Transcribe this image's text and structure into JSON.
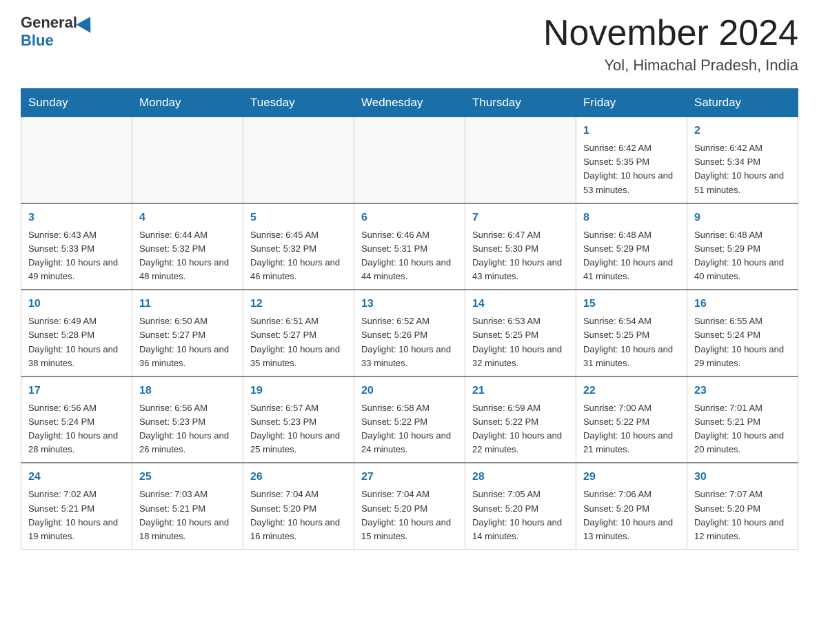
{
  "header": {
    "logo_general": "General",
    "logo_blue": "Blue",
    "month_title": "November 2024",
    "location": "Yol, Himachal Pradesh, India"
  },
  "days_of_week": [
    "Sunday",
    "Monday",
    "Tuesday",
    "Wednesday",
    "Thursday",
    "Friday",
    "Saturday"
  ],
  "weeks": [
    {
      "days": [
        {
          "number": "",
          "info": ""
        },
        {
          "number": "",
          "info": ""
        },
        {
          "number": "",
          "info": ""
        },
        {
          "number": "",
          "info": ""
        },
        {
          "number": "",
          "info": ""
        },
        {
          "number": "1",
          "info": "Sunrise: 6:42 AM\nSunset: 5:35 PM\nDaylight: 10 hours and 53 minutes."
        },
        {
          "number": "2",
          "info": "Sunrise: 6:42 AM\nSunset: 5:34 PM\nDaylight: 10 hours and 51 minutes."
        }
      ]
    },
    {
      "days": [
        {
          "number": "3",
          "info": "Sunrise: 6:43 AM\nSunset: 5:33 PM\nDaylight: 10 hours and 49 minutes."
        },
        {
          "number": "4",
          "info": "Sunrise: 6:44 AM\nSunset: 5:32 PM\nDaylight: 10 hours and 48 minutes."
        },
        {
          "number": "5",
          "info": "Sunrise: 6:45 AM\nSunset: 5:32 PM\nDaylight: 10 hours and 46 minutes."
        },
        {
          "number": "6",
          "info": "Sunrise: 6:46 AM\nSunset: 5:31 PM\nDaylight: 10 hours and 44 minutes."
        },
        {
          "number": "7",
          "info": "Sunrise: 6:47 AM\nSunset: 5:30 PM\nDaylight: 10 hours and 43 minutes."
        },
        {
          "number": "8",
          "info": "Sunrise: 6:48 AM\nSunset: 5:29 PM\nDaylight: 10 hours and 41 minutes."
        },
        {
          "number": "9",
          "info": "Sunrise: 6:48 AM\nSunset: 5:29 PM\nDaylight: 10 hours and 40 minutes."
        }
      ]
    },
    {
      "days": [
        {
          "number": "10",
          "info": "Sunrise: 6:49 AM\nSunset: 5:28 PM\nDaylight: 10 hours and 38 minutes."
        },
        {
          "number": "11",
          "info": "Sunrise: 6:50 AM\nSunset: 5:27 PM\nDaylight: 10 hours and 36 minutes."
        },
        {
          "number": "12",
          "info": "Sunrise: 6:51 AM\nSunset: 5:27 PM\nDaylight: 10 hours and 35 minutes."
        },
        {
          "number": "13",
          "info": "Sunrise: 6:52 AM\nSunset: 5:26 PM\nDaylight: 10 hours and 33 minutes."
        },
        {
          "number": "14",
          "info": "Sunrise: 6:53 AM\nSunset: 5:25 PM\nDaylight: 10 hours and 32 minutes."
        },
        {
          "number": "15",
          "info": "Sunrise: 6:54 AM\nSunset: 5:25 PM\nDaylight: 10 hours and 31 minutes."
        },
        {
          "number": "16",
          "info": "Sunrise: 6:55 AM\nSunset: 5:24 PM\nDaylight: 10 hours and 29 minutes."
        }
      ]
    },
    {
      "days": [
        {
          "number": "17",
          "info": "Sunrise: 6:56 AM\nSunset: 5:24 PM\nDaylight: 10 hours and 28 minutes."
        },
        {
          "number": "18",
          "info": "Sunrise: 6:56 AM\nSunset: 5:23 PM\nDaylight: 10 hours and 26 minutes."
        },
        {
          "number": "19",
          "info": "Sunrise: 6:57 AM\nSunset: 5:23 PM\nDaylight: 10 hours and 25 minutes."
        },
        {
          "number": "20",
          "info": "Sunrise: 6:58 AM\nSunset: 5:22 PM\nDaylight: 10 hours and 24 minutes."
        },
        {
          "number": "21",
          "info": "Sunrise: 6:59 AM\nSunset: 5:22 PM\nDaylight: 10 hours and 22 minutes."
        },
        {
          "number": "22",
          "info": "Sunrise: 7:00 AM\nSunset: 5:22 PM\nDaylight: 10 hours and 21 minutes."
        },
        {
          "number": "23",
          "info": "Sunrise: 7:01 AM\nSunset: 5:21 PM\nDaylight: 10 hours and 20 minutes."
        }
      ]
    },
    {
      "days": [
        {
          "number": "24",
          "info": "Sunrise: 7:02 AM\nSunset: 5:21 PM\nDaylight: 10 hours and 19 minutes."
        },
        {
          "number": "25",
          "info": "Sunrise: 7:03 AM\nSunset: 5:21 PM\nDaylight: 10 hours and 18 minutes."
        },
        {
          "number": "26",
          "info": "Sunrise: 7:04 AM\nSunset: 5:20 PM\nDaylight: 10 hours and 16 minutes."
        },
        {
          "number": "27",
          "info": "Sunrise: 7:04 AM\nSunset: 5:20 PM\nDaylight: 10 hours and 15 minutes."
        },
        {
          "number": "28",
          "info": "Sunrise: 7:05 AM\nSunset: 5:20 PM\nDaylight: 10 hours and 14 minutes."
        },
        {
          "number": "29",
          "info": "Sunrise: 7:06 AM\nSunset: 5:20 PM\nDaylight: 10 hours and 13 minutes."
        },
        {
          "number": "30",
          "info": "Sunrise: 7:07 AM\nSunset: 5:20 PM\nDaylight: 10 hours and 12 minutes."
        }
      ]
    }
  ]
}
